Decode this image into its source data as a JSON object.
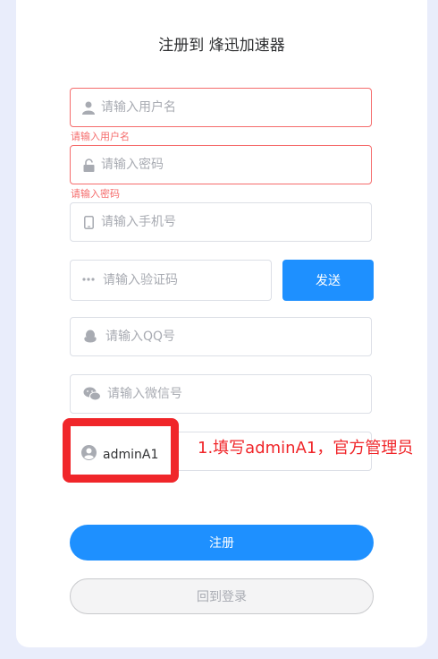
{
  "title": "注册到 烽迅加速器",
  "fields": {
    "username": {
      "placeholder": "请输入用户名",
      "error": "请输入用户名",
      "icon": "user-icon"
    },
    "password": {
      "placeholder": "请输入密码",
      "error": "请输入密码",
      "icon": "lock-icon"
    },
    "phone": {
      "placeholder": "请输入手机号",
      "icon": "mobile-icon"
    },
    "code": {
      "placeholder": "请输入验证码",
      "icon": "dots-icon"
    },
    "qq": {
      "placeholder": "请输入QQ号",
      "icon": "qq-icon"
    },
    "wechat": {
      "placeholder": "请输入微信号",
      "icon": "wechat-icon"
    },
    "inviter": {
      "value": "adminA1",
      "icon": "user-circle-icon"
    }
  },
  "send_label": "发送",
  "annotation": "1.填写adminA1，官方管理员",
  "submit_label": "注册",
  "back_label": "回到登录",
  "colors": {
    "primary": "#1e90ff",
    "error": "#f56c6c",
    "annotation": "#f0262a"
  }
}
